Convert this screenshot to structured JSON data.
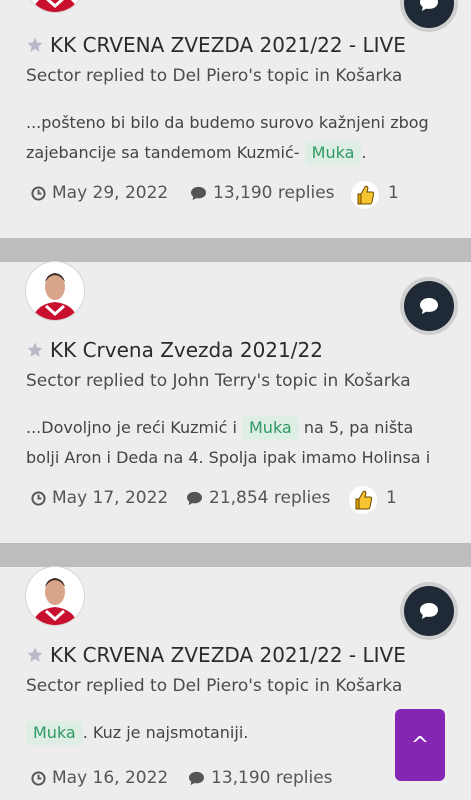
{
  "posts": [
    {
      "title": "KK CRVENA ZVEZDA 2021/22 - LIVE",
      "meta": "Sector replied to Del Piero's topic in Košarka",
      "snippet_before": "...pošteno bi bilo da budemo surovo kažnjeni zbog zajebancije sa tandemom Kuzmić-",
      "tag": "Muka",
      "snippet_after": ".",
      "date": "May 29, 2022",
      "replies": "13,190 replies",
      "reactions": "1"
    },
    {
      "title": "KK Crvena Zvezda 2021/22",
      "meta": "Sector replied to John Terry's topic in Košarka",
      "snippet_before": "...Dovoljno je reći Kuzmić i",
      "tag": "Muka",
      "snippet_after": "na 5, pa ništa bolji Aron i Deda na 4. Spolja ipak imamo Holinsa i",
      "date": "May 17, 2022",
      "replies": "21,854 replies",
      "reactions": "1"
    },
    {
      "title": "KK CRVENA ZVEZDA 2021/22 - LIVE",
      "meta": "Sector replied to Del Piero's topic in Košarka",
      "tag": "Muka",
      "snippet_after": ". Kuz je najsmotaniji.",
      "date": "May 16, 2022",
      "replies": "13,190 replies"
    }
  ],
  "scroll_top_label": "^",
  "colors": {
    "accent": "#7a2fb8",
    "tag_bg": "#dfeee4",
    "tag_text": "#2f9a62",
    "chat_btn": "#1f2a36"
  }
}
